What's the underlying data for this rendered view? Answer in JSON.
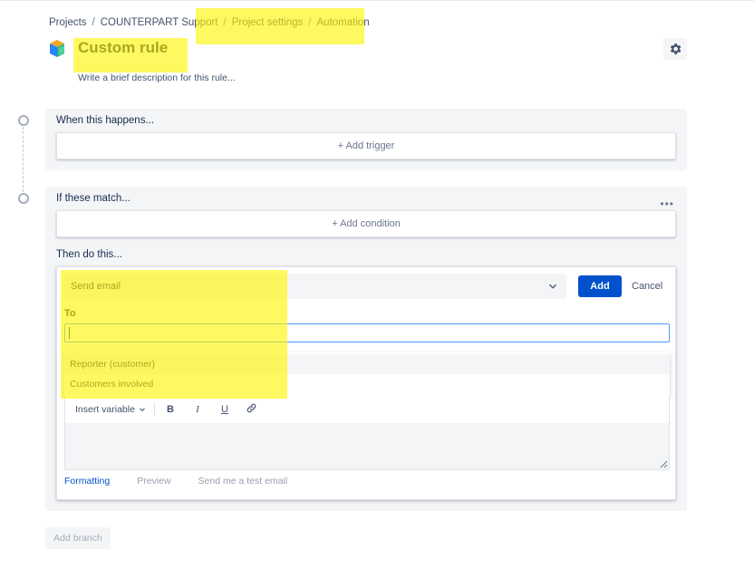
{
  "breadcrumb": {
    "items": [
      "Projects",
      "COUNTERPART Support",
      "Project settings",
      "Automation"
    ],
    "separator": "/"
  },
  "rule": {
    "title": "Custom rule",
    "description_placeholder": "Write a brief description for this rule..."
  },
  "trigger_section": {
    "label": "When this happens...",
    "add_label": "+ Add trigger"
  },
  "condition_section": {
    "label": "If these match...",
    "add_label": "+ Add condition",
    "more_icon": "more-horizontal-icon"
  },
  "action_section": {
    "label": "Then do this...",
    "selected_action": "Send email",
    "add_button": "Add",
    "cancel_button": "Cancel",
    "to_label": "To",
    "to_value": "",
    "to_options": [
      "Reporter (customer)",
      "Customers involved"
    ],
    "toolbar": {
      "insert_variable": "Insert variable",
      "bold": "B",
      "italic": "I",
      "underline": "U",
      "link_icon": "link-icon"
    },
    "tabs": [
      "Formatting",
      "Preview",
      "Send me a test email"
    ]
  },
  "add_branch_label": "Add branch",
  "colors": {
    "primary": "#0052cc",
    "highlight": "#fff500",
    "panel_bg": "#f4f5f7"
  }
}
